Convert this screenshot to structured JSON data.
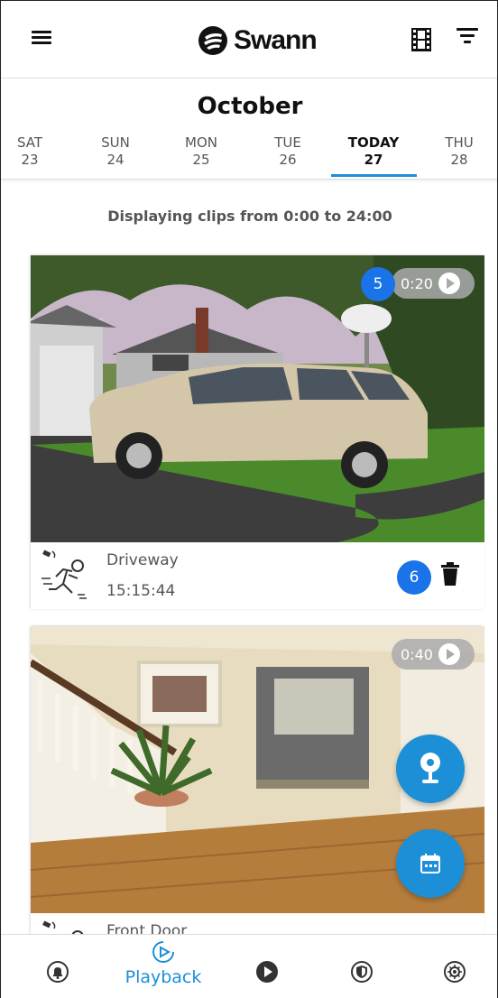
{
  "app": {
    "brand": "Swann"
  },
  "calendar": {
    "month": "October",
    "days": [
      {
        "name": "SAT",
        "num": "23"
      },
      {
        "name": "SUN",
        "num": "24"
      },
      {
        "name": "MON",
        "num": "25"
      },
      {
        "name": "TUE",
        "num": "26"
      },
      {
        "name": "TODAY",
        "num": "27",
        "selected": true
      },
      {
        "name": "THU",
        "num": "28"
      }
    ]
  },
  "range_text": "Displaying clips from 0:00 to 24:00",
  "clips": [
    {
      "camera": "Driveway",
      "time": "15:15:44",
      "duration": "0:20",
      "badges": [
        "5",
        "6"
      ]
    },
    {
      "camera": "Front Door",
      "duration": "0:40"
    }
  ],
  "bottom_nav": {
    "active_label": "Playback",
    "items": [
      "alerts-icon",
      "playback-icon",
      "live-play-icon",
      "security-icon",
      "settings-icon"
    ]
  },
  "colors": {
    "accent": "#1c8fd6",
    "badge": "#1a73e8"
  }
}
